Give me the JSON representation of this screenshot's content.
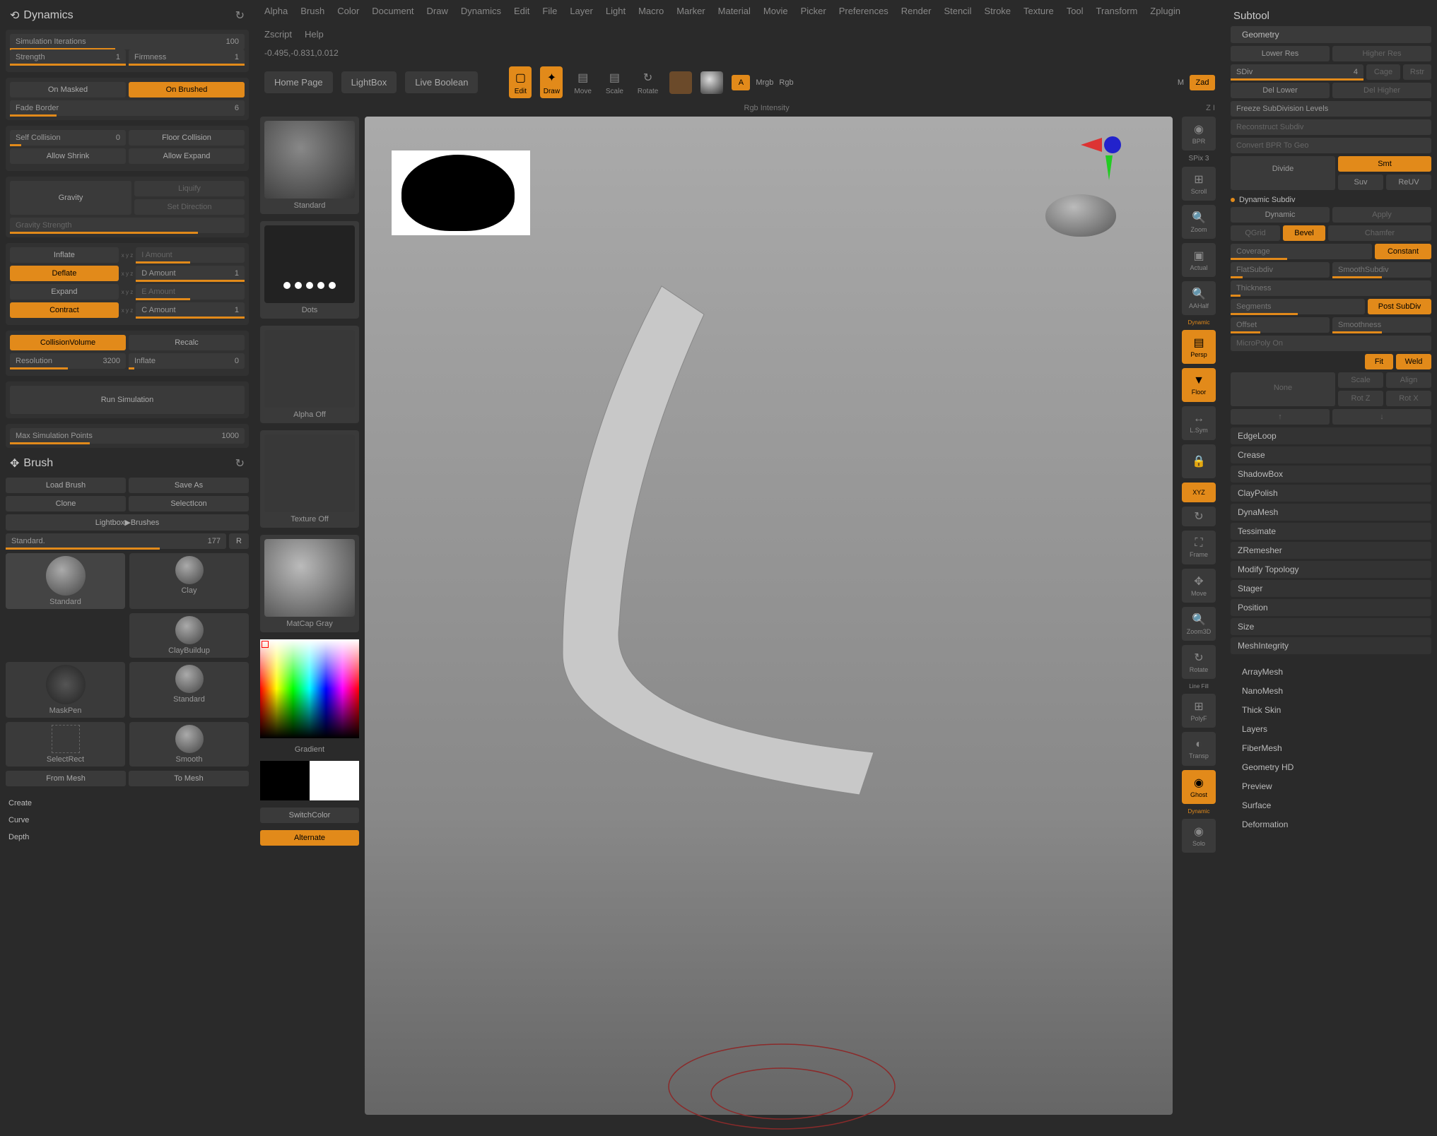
{
  "left": {
    "dynamics": {
      "title": "Dynamics",
      "sim_iter": "Simulation Iterations",
      "sim_iter_val": "100",
      "strength": "Strength",
      "strength_val": "1",
      "firmness": "Firmness",
      "firmness_val": "1",
      "on_masked": "On Masked",
      "on_brushed": "On Brushed",
      "fade_border": "Fade Border",
      "fade_border_val": "6",
      "self_collision": "Self Collision",
      "self_collision_val": "0",
      "floor_collision": "Floor Collision",
      "allow_shrink": "Allow Shrink",
      "allow_expand": "Allow Expand",
      "gravity": "Gravity",
      "liquify": "Liquify",
      "set_direction": "Set Direction",
      "gravity_strength": "Gravity Strength",
      "inflate": "Inflate",
      "i_amount": "I Amount",
      "deflate": "Deflate",
      "d_amount": "D Amount",
      "d_amount_val": "1",
      "expand": "Expand",
      "e_amount": "E Amount",
      "contract": "Contract",
      "c_amount": "C Amount",
      "c_amount_val": "1",
      "collision_volume": "CollisionVolume",
      "recalc": "Recalc",
      "resolution": "Resolution",
      "resolution_val": "3200",
      "inflate2": "Inflate",
      "inflate2_val": "0",
      "run_sim": "Run Simulation",
      "max_sim": "Max Simulation Points",
      "max_sim_val": "1000"
    },
    "brush": {
      "title": "Brush",
      "load": "Load Brush",
      "save_as": "Save As",
      "clone": "Clone",
      "select_icon": "SelectIcon",
      "lightbox": "Lightbox▶Brushes",
      "standard": "Standard.",
      "standard_val": "177",
      "r": "R",
      "brushes": [
        "Standard",
        "Clay",
        "ClayBuildup",
        "MaskPen",
        "Standard",
        "SelectRect",
        "Smooth"
      ],
      "from_mesh": "From Mesh",
      "to_mesh": "To Mesh",
      "create": "Create",
      "curve": "Curve",
      "depth": "Depth"
    }
  },
  "strip": {
    "standard": "Standard",
    "dots": "Dots",
    "alpha_off": "Alpha Off",
    "texture_off": "Texture Off",
    "matcap_gray": "MatCap Gray",
    "gradient": "Gradient",
    "switch_color": "SwitchColor",
    "alternate": "Alternate"
  },
  "menus": [
    "Alpha",
    "Brush",
    "Color",
    "Document",
    "Draw",
    "Dynamics",
    "Edit",
    "File",
    "Layer",
    "Light",
    "Macro",
    "Marker",
    "Material",
    "Movie",
    "Picker",
    "Preferences",
    "Render",
    "Stencil",
    "Stroke",
    "Texture",
    "Tool",
    "Transform",
    "Zplugin",
    "Zscript",
    "Help"
  ],
  "coords": "-0.495,-0.831,0.012",
  "toolbar": {
    "home": "Home Page",
    "lightbox": "LightBox",
    "live_boolean": "Live Boolean",
    "edit": "Edit",
    "draw": "Draw",
    "move": "Move",
    "scale": "Scale",
    "rotate": "Rotate",
    "a": "A",
    "mrgb": "Mrgb",
    "rgb": "Rgb",
    "m": "M",
    "zad": "Zad",
    "rgb_intensity": "Rgb Intensity",
    "zi": "Z I"
  },
  "right_tools": [
    "BPR",
    "SPix 3",
    "Scroll",
    "Zoom",
    "Actual",
    "AAHalf",
    "Persp",
    "Floor",
    "L.Sym",
    "XYZ",
    "Frame",
    "Move",
    "Zoom3D",
    "Rotate",
    "PolyF",
    "Transp",
    "Ghost",
    "Solo"
  ],
  "right_tools_extra": {
    "dynamic": "Dynamic",
    "line_fill": "Line Fill"
  },
  "right": {
    "subtool": "Subtool",
    "geometry": {
      "title": "Geometry",
      "lower_res": "Lower Res",
      "higher_res": "Higher Res",
      "sdiv": "SDiv",
      "sdiv_val": "4",
      "cage": "Cage",
      "rstr": "Rstr",
      "del_lower": "Del Lower",
      "del_higher": "Del Higher",
      "freeze": "Freeze SubDivision Levels",
      "reconstruct": "Reconstruct Subdiv",
      "convert_bpr": "Convert BPR To Geo",
      "divide": "Divide",
      "smt": "Smt",
      "suv": "Suv",
      "reuv": "ReUV"
    },
    "dyn_subdiv": {
      "title": "Dynamic Subdiv",
      "dynamic": "Dynamic",
      "apply": "Apply",
      "qgrid": "QGrid",
      "bevel": "Bevel",
      "chamfer": "Chamfer",
      "coverage": "Coverage",
      "constant": "Constant",
      "flat": "FlatSubdiv",
      "smooth": "SmoothSubdiv",
      "thickness": "Thickness",
      "segments": "Segments",
      "post_subdiv": "Post SubDiv",
      "offset": "Offset",
      "smoothness": "Smoothness",
      "micropoly": "MicroPoly On",
      "fit": "Fit",
      "weld": "Weld",
      "none": "None",
      "scale": "Scale",
      "align": "Align",
      "rotz": "Rot Z",
      "rotx": "Rot X"
    },
    "subsections": [
      "EdgeLoop",
      "Crease",
      "ShadowBox",
      "ClayPolish",
      "DynaMesh",
      "Tessimate",
      "ZRemesher",
      "Modify Topology",
      "Stager",
      "Position",
      "Size",
      "MeshIntegrity"
    ],
    "subsections2": [
      "ArrayMesh",
      "NanoMesh",
      "Thick Skin",
      "Layers",
      "FiberMesh",
      "Geometry HD",
      "Preview",
      "Surface",
      "Deformation"
    ]
  }
}
